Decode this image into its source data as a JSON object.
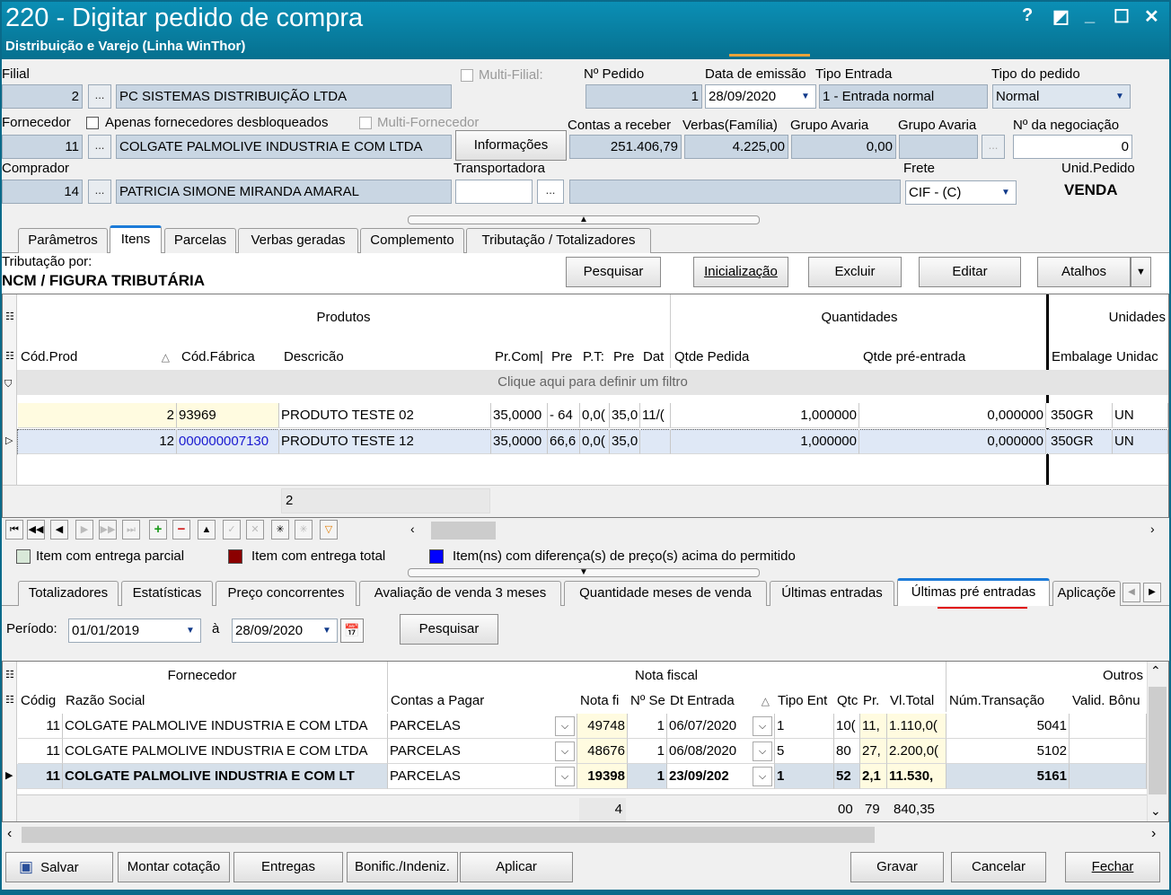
{
  "window": {
    "title": "220 - Digitar pedido de compra",
    "subtitle": "Distribuição e Varejo (Linha WinThor)",
    "help": "?",
    "restore": "◩",
    "minimize": "_",
    "maximize": "☐",
    "close": "✕"
  },
  "header": {
    "filial_label": "Filial",
    "filial_code": "2",
    "filial_name": "PC SISTEMAS DISTRIBUIÇÃO LTDA",
    "multi_filial_label": "Multi-Filial:",
    "pedido_label": "Nº Pedido",
    "pedido_value": "1",
    "emissao_label": "Data de emissão",
    "emissao_value": "28/09/2020",
    "tipo_entrada_label": "Tipo Entrada",
    "tipo_entrada_value": "1 - Entrada normal",
    "tipo_pedido_label": "Tipo do pedido",
    "tipo_pedido_value": "Normal",
    "fornecedor_label": "Fornecedor",
    "apenas_label": "Apenas fornecedores desbloqueados",
    "multi_fornecedor_label": "Multi-Fornecedor",
    "fornecedor_code": "11",
    "fornecedor_name": "COLGATE PALMOLIVE INDUSTRIA  E COM LTDA",
    "informacoes_label": "Informações",
    "contas_label": "Contas a receber",
    "contas_value": "251.406,79",
    "verbas_label": "Verbas(Família)",
    "verbas_value": "4.225,00",
    "grupo_avaria1_label": "Grupo Avaria",
    "grupo_avaria1_value": "0,00",
    "grupo_avaria2_label": "Grupo Avaria",
    "negociacao_label": "Nº da negociação",
    "negociacao_value": "0",
    "comprador_label": "Comprador",
    "comprador_code": "14",
    "comprador_name": "PATRICIA SIMONE MIRANDA AMARAL",
    "transportadora_label": "Transportadora",
    "frete_label": "Frete",
    "frete_value": "CIF - (C)",
    "unid_label": "Unid.Pedido",
    "unid_value": "VENDA",
    "dots": "..."
  },
  "top_tabs": [
    "Parâmetros",
    "Itens",
    "Parcelas",
    "Verbas geradas",
    "Complemento",
    "Tributação / Totalizadores"
  ],
  "tributacao": {
    "label": "Tributação por:",
    "value": "NCM / FIGURA TRIBUTÁRIA"
  },
  "item_buttons": {
    "pesquisar": "Pesquisar",
    "inicializacao": "Inicialização",
    "excluir": "Excluir",
    "editar": "Editar",
    "atalhos": "Atalhos"
  },
  "items_grid": {
    "band_produtos": "Produtos",
    "band_quantidades": "Quantidades",
    "band_unidades": "Unidades",
    "columns": [
      "Cód.Prod",
      "Cód.Fábrica",
      "Descricão",
      "Pr.Com|",
      "Pre",
      "P.T:",
      "Pre",
      "Dat",
      "Qtde Pedida",
      "Qtde pré-entrada",
      "Embalage",
      "Unidac"
    ],
    "filter_hint": "Clique aqui para definir um filtro",
    "rows": [
      [
        "2",
        "93969",
        "PRODUTO TESTE 02",
        "35,0000",
        "- 64",
        "0,0(",
        "35,0",
        "11/(",
        "1,000000",
        "0,000000",
        "350GR",
        "UN"
      ],
      [
        "12",
        "000000007130",
        "PRODUTO TESTE 12",
        "35,0000",
        "66,6",
        "0,0(",
        "35,0",
        "",
        "1,000000",
        "0,000000",
        "350GR",
        "UN"
      ]
    ],
    "footer_count": "2"
  },
  "legend": {
    "parcial": "Item com entrega parcial",
    "total": "Item com entrega total",
    "diferenca": "Item(ns) com diferença(s) de preço(s) acima do permitido",
    "colors": {
      "parcial": "#d8e8d8",
      "total": "#8b0000",
      "diferenca": "#0000ff"
    }
  },
  "bottom_tabs": [
    "Totalizadores",
    "Estatísticas",
    "Preço concorrentes",
    "Avaliação de venda 3 meses",
    "Quantidade meses de venda",
    "Últimas entradas",
    "Últimas pré entradas",
    "Aplicaçõe"
  ],
  "periodo": {
    "label": "Período:",
    "start": "01/01/2019",
    "sep": "à",
    "end": "28/09/2020",
    "button": "Pesquisar"
  },
  "entries_grid": {
    "band_fornecedor": "Fornecedor",
    "band_nota": "Nota fiscal",
    "band_outros": "Outros",
    "columns": [
      "Códig",
      "Razão Social",
      "Contas a Pagar",
      "Nota fi",
      "Nº Se",
      "Dt Entrada",
      "Tipo Ent",
      "Qtc",
      "Pr.",
      "Vl.Total",
      "Núm.Transação",
      "Valid. Bônu"
    ],
    "rows": [
      [
        "11",
        "COLGATE PALMOLIVE INDUSTRIA  E COM LTDA",
        "PARCELAS",
        "49748",
        "1",
        "06/07/2020",
        "1",
        "10(",
        "11,",
        "1.110,0(",
        "5041",
        ""
      ],
      [
        "11",
        "COLGATE PALMOLIVE INDUSTRIA  E COM LTDA",
        "PARCELAS",
        "48676",
        "1",
        "06/08/2020",
        "5",
        "80",
        "27,",
        "2.200,0(",
        "5102",
        ""
      ],
      [
        "11",
        "COLGATE PALMOLIVE INDUSTRIA  E COM LT",
        "PARCELAS",
        "19398",
        "1",
        "23/09/202",
        "1",
        "52",
        "2,1",
        "11.530,",
        "5161",
        ""
      ]
    ],
    "footer": {
      "nota": "4",
      "qtd": "00",
      "pr": "79",
      "total": "840,35"
    }
  },
  "bottom_buttons": {
    "salvar": "Salvar",
    "montar": "Montar cotação",
    "entregas": "Entregas",
    "bonific": "Bonific./Indeniz.",
    "aplicar": "Aplicar",
    "gravar": "Gravar",
    "cancelar": "Cancelar",
    "fechar": "Fechar"
  }
}
